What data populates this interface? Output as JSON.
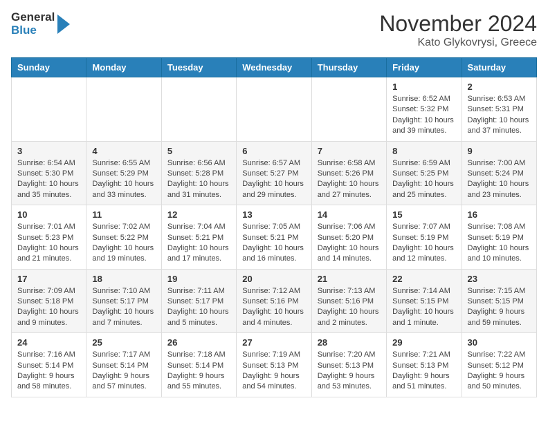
{
  "logo": {
    "general": "General",
    "blue": "Blue"
  },
  "header": {
    "month": "November 2024",
    "location": "Kato Glykovrysi, Greece"
  },
  "weekdays": [
    "Sunday",
    "Monday",
    "Tuesday",
    "Wednesday",
    "Thursday",
    "Friday",
    "Saturday"
  ],
  "weeks": [
    [
      {
        "day": "",
        "info": ""
      },
      {
        "day": "",
        "info": ""
      },
      {
        "day": "",
        "info": ""
      },
      {
        "day": "",
        "info": ""
      },
      {
        "day": "",
        "info": ""
      },
      {
        "day": "1",
        "info": "Sunrise: 6:52 AM\nSunset: 5:32 PM\nDaylight: 10 hours and 39 minutes."
      },
      {
        "day": "2",
        "info": "Sunrise: 6:53 AM\nSunset: 5:31 PM\nDaylight: 10 hours and 37 minutes."
      }
    ],
    [
      {
        "day": "3",
        "info": "Sunrise: 6:54 AM\nSunset: 5:30 PM\nDaylight: 10 hours and 35 minutes."
      },
      {
        "day": "4",
        "info": "Sunrise: 6:55 AM\nSunset: 5:29 PM\nDaylight: 10 hours and 33 minutes."
      },
      {
        "day": "5",
        "info": "Sunrise: 6:56 AM\nSunset: 5:28 PM\nDaylight: 10 hours and 31 minutes."
      },
      {
        "day": "6",
        "info": "Sunrise: 6:57 AM\nSunset: 5:27 PM\nDaylight: 10 hours and 29 minutes."
      },
      {
        "day": "7",
        "info": "Sunrise: 6:58 AM\nSunset: 5:26 PM\nDaylight: 10 hours and 27 minutes."
      },
      {
        "day": "8",
        "info": "Sunrise: 6:59 AM\nSunset: 5:25 PM\nDaylight: 10 hours and 25 minutes."
      },
      {
        "day": "9",
        "info": "Sunrise: 7:00 AM\nSunset: 5:24 PM\nDaylight: 10 hours and 23 minutes."
      }
    ],
    [
      {
        "day": "10",
        "info": "Sunrise: 7:01 AM\nSunset: 5:23 PM\nDaylight: 10 hours and 21 minutes."
      },
      {
        "day": "11",
        "info": "Sunrise: 7:02 AM\nSunset: 5:22 PM\nDaylight: 10 hours and 19 minutes."
      },
      {
        "day": "12",
        "info": "Sunrise: 7:04 AM\nSunset: 5:21 PM\nDaylight: 10 hours and 17 minutes."
      },
      {
        "day": "13",
        "info": "Sunrise: 7:05 AM\nSunset: 5:21 PM\nDaylight: 10 hours and 16 minutes."
      },
      {
        "day": "14",
        "info": "Sunrise: 7:06 AM\nSunset: 5:20 PM\nDaylight: 10 hours and 14 minutes."
      },
      {
        "day": "15",
        "info": "Sunrise: 7:07 AM\nSunset: 5:19 PM\nDaylight: 10 hours and 12 minutes."
      },
      {
        "day": "16",
        "info": "Sunrise: 7:08 AM\nSunset: 5:19 PM\nDaylight: 10 hours and 10 minutes."
      }
    ],
    [
      {
        "day": "17",
        "info": "Sunrise: 7:09 AM\nSunset: 5:18 PM\nDaylight: 10 hours and 9 minutes."
      },
      {
        "day": "18",
        "info": "Sunrise: 7:10 AM\nSunset: 5:17 PM\nDaylight: 10 hours and 7 minutes."
      },
      {
        "day": "19",
        "info": "Sunrise: 7:11 AM\nSunset: 5:17 PM\nDaylight: 10 hours and 5 minutes."
      },
      {
        "day": "20",
        "info": "Sunrise: 7:12 AM\nSunset: 5:16 PM\nDaylight: 10 hours and 4 minutes."
      },
      {
        "day": "21",
        "info": "Sunrise: 7:13 AM\nSunset: 5:16 PM\nDaylight: 10 hours and 2 minutes."
      },
      {
        "day": "22",
        "info": "Sunrise: 7:14 AM\nSunset: 5:15 PM\nDaylight: 10 hours and 1 minute."
      },
      {
        "day": "23",
        "info": "Sunrise: 7:15 AM\nSunset: 5:15 PM\nDaylight: 9 hours and 59 minutes."
      }
    ],
    [
      {
        "day": "24",
        "info": "Sunrise: 7:16 AM\nSunset: 5:14 PM\nDaylight: 9 hours and 58 minutes."
      },
      {
        "day": "25",
        "info": "Sunrise: 7:17 AM\nSunset: 5:14 PM\nDaylight: 9 hours and 57 minutes."
      },
      {
        "day": "26",
        "info": "Sunrise: 7:18 AM\nSunset: 5:14 PM\nDaylight: 9 hours and 55 minutes."
      },
      {
        "day": "27",
        "info": "Sunrise: 7:19 AM\nSunset: 5:13 PM\nDaylight: 9 hours and 54 minutes."
      },
      {
        "day": "28",
        "info": "Sunrise: 7:20 AM\nSunset: 5:13 PM\nDaylight: 9 hours and 53 minutes."
      },
      {
        "day": "29",
        "info": "Sunrise: 7:21 AM\nSunset: 5:13 PM\nDaylight: 9 hours and 51 minutes."
      },
      {
        "day": "30",
        "info": "Sunrise: 7:22 AM\nSunset: 5:12 PM\nDaylight: 9 hours and 50 minutes."
      }
    ]
  ]
}
